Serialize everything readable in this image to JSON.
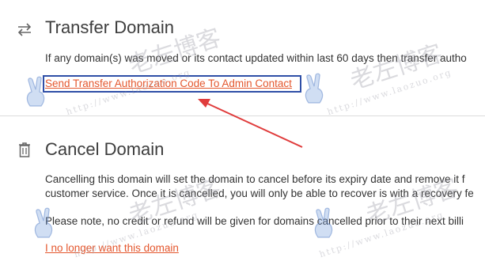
{
  "transfer": {
    "title": "Transfer Domain",
    "description": "If any domain(s) was moved or its contact updated within last 60 days then transfer autho",
    "link": "Send Transfer Authorization Code To Admin Contact"
  },
  "cancel": {
    "title": "Cancel Domain",
    "description_line1": "Cancelling this domain will set the domain to cancel before its expiry date and remove it f",
    "description_line2": "customer service. Once it is cancelled, you will only be able to recover is with a recovery fe",
    "note": "Please note, no credit or refund will be given for domains cancelled prior to their next billi",
    "link": "I no longer want this domain"
  },
  "watermark": {
    "text": "老左博客",
    "url": "http://www.laozuo.org"
  },
  "colors": {
    "link": "#e4572e",
    "annotation_box": "#2f4fa7",
    "arrow": "#e03c3c"
  },
  "icons": {
    "transfer": "transfer-arrows-icon",
    "cancel": "trash-icon"
  }
}
